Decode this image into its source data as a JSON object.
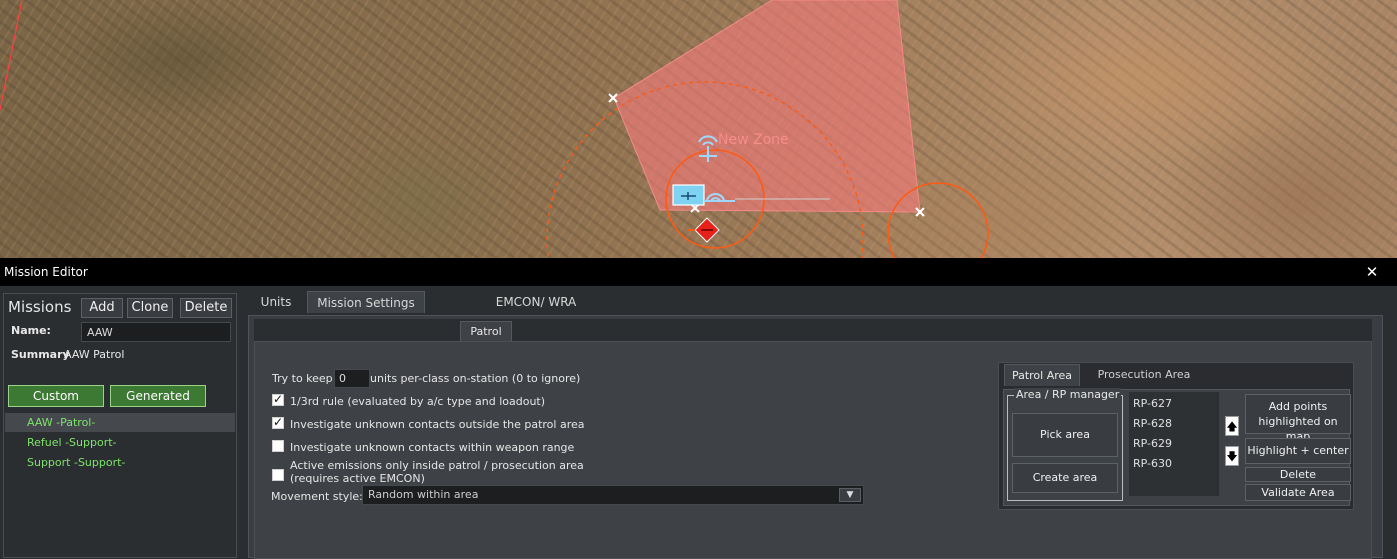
{
  "map": {
    "zone_label": "New Zone",
    "icons": [
      "waypoint-x-icon",
      "radar-emitter-icon",
      "air-unit-icon",
      "hostile-diamond-icon"
    ],
    "colors": {
      "zone_fill": "#f47a7a",
      "range_ring": "#ff5a14"
    }
  },
  "window": {
    "title": "Mission Editor",
    "close_label": "✕"
  },
  "missions_panel": {
    "header": "Missions",
    "add_label": "Add",
    "clone_label": "Clone",
    "delete_label": "Delete",
    "name_label": "Name:",
    "name_value": "AAW",
    "summary_label": "Summary",
    "summary_value": "AAW Patrol",
    "custom_label": "Custom",
    "generated_label": "Generated",
    "items": [
      {
        "label": "AAW  -Patrol-",
        "selected": true
      },
      {
        "label": "Refuel  -Support-",
        "selected": false
      },
      {
        "label": "Support -Support-",
        "selected": false
      }
    ]
  },
  "tabs": [
    {
      "label": "Units",
      "active": false
    },
    {
      "label": "Mission Settings",
      "active": true
    },
    {
      "label": "EMCON/ WRA",
      "active": false
    }
  ],
  "patrol": {
    "tab_label": "Patrol",
    "keep_prefix": "Try to keep",
    "keep_value": "0",
    "keep_suffix": "units per-class on-station (0 to ignore)",
    "checks": [
      {
        "label": "1/3rd rule (evaluated by a/c type and loadout)",
        "checked": true
      },
      {
        "label": "Investigate unknown contacts outside the patrol area",
        "checked": true
      },
      {
        "label": "Investigate unknown contacts within weapon range",
        "checked": false
      },
      {
        "label": "Active emissions only inside patrol / prosecution area",
        "label2": "(requires active EMCON)",
        "checked": false
      }
    ],
    "movement_label": "Movement style:",
    "movement_value": "Random within area"
  },
  "area": {
    "patrol_tab": "Patrol Area",
    "prosecution_tab": "Prosecution Area",
    "rp_manager_label": "Area / RP manager",
    "pick_label": "Pick area",
    "create_label": "Create area",
    "rp_points": [
      "RP-627",
      "RP-628",
      "RP-629",
      "RP-630"
    ],
    "up_label": "🡅",
    "down_label": "🡇",
    "add_points_label": "Add points highlighted on map",
    "highlight_label": "Highlight + center",
    "delete_label": "Delete",
    "validate_label": "Validate Area"
  }
}
